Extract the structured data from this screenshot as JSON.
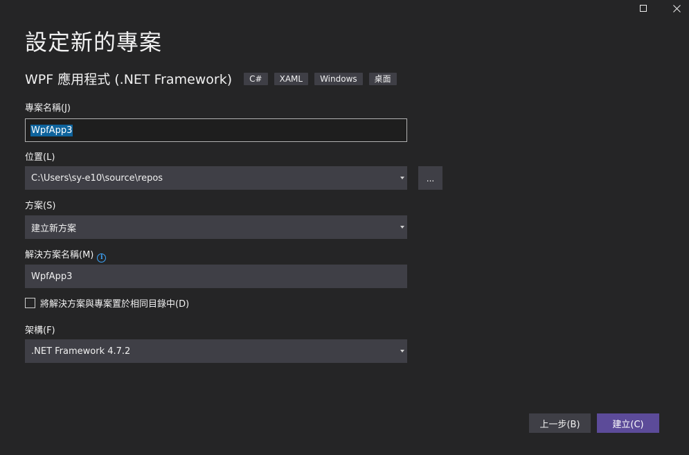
{
  "window": {
    "maximize_icon": "maximize-icon",
    "close_icon": "close-icon"
  },
  "page": {
    "title": "設定新的專案"
  },
  "template": {
    "name": "WPF 應用程式 (.NET Framework)",
    "tags": [
      "C#",
      "XAML",
      "Windows",
      "桌面"
    ]
  },
  "form": {
    "project_name": {
      "label": "專案名稱(J)",
      "value": "WpfApp3"
    },
    "location": {
      "label": "位置(L)",
      "value": "C:\\Users\\sy-e10\\source\\repos",
      "browse_label": "..."
    },
    "solution": {
      "label": "方案(S)",
      "value": "建立新方案"
    },
    "solution_name": {
      "label": "解決方案名稱(M)",
      "info_icon": "info-icon",
      "value": "WpfApp3"
    },
    "same_directory": {
      "label": "將解決方案與專案置於相同目錄中(D)",
      "checked": false
    },
    "framework": {
      "label": "架構(F)",
      "value": ".NET Framework 4.7.2"
    }
  },
  "footer": {
    "back_label": "上一步(B)",
    "create_label": "建立(C)"
  },
  "colors": {
    "background": "#252526",
    "field": "#3f3f46",
    "primary_button": "#5c4b99",
    "selection": "#0e639c",
    "info": "#3ea8ff"
  }
}
